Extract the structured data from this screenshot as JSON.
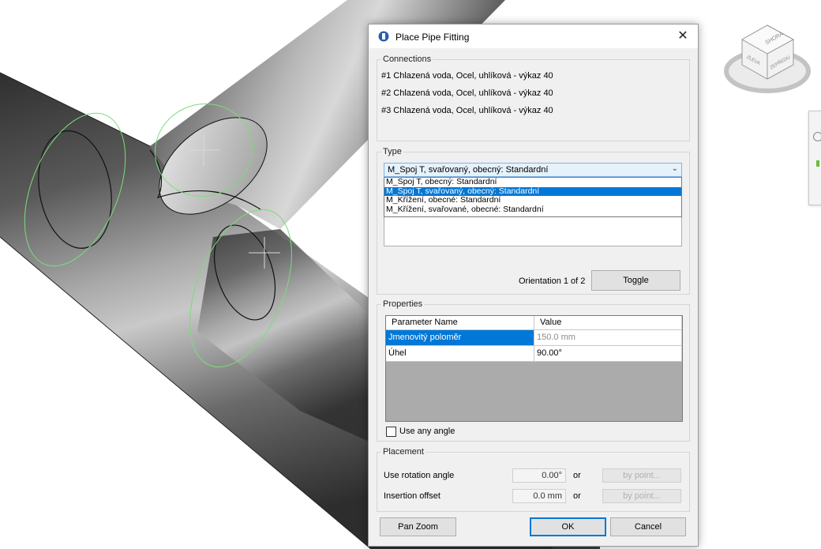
{
  "dialog": {
    "title": "Place Pipe Fitting",
    "close_glyph": "✕",
    "icon": "revit-fitting-icon"
  },
  "connections": {
    "legend": "Connections",
    "items": [
      "#1 Chlazená voda, Ocel, uhlíková - výkaz 40",
      "#2 Chlazená voda, Ocel, uhlíková - výkaz 40",
      "#3 Chlazená voda, Ocel, uhlíková - výkaz 40"
    ]
  },
  "type": {
    "legend": "Type",
    "selected": "M_Spoj T, svařovaný, obecný: Standardní",
    "options": [
      "M_Spoj T, obecný: Standardní",
      "M_Spoj T, svařovaný, obecný: Standardní",
      "M_Křížení, obecné: Standardní",
      "M_Křížení, svařované, obecné: Standardní"
    ],
    "highlighted_index": 1,
    "orientation_text": "Orientation 1 of 2",
    "toggle_label": "Toggle"
  },
  "properties": {
    "legend": "Properties",
    "headers": {
      "name": "Parameter Name",
      "value": "Value"
    },
    "rows": [
      {
        "name": "Jmenovitý poloměr",
        "value": "150.0 mm"
      },
      {
        "name": "Úhel",
        "value": "90.00°"
      }
    ],
    "use_any_angle_label": "Use any angle",
    "use_any_angle_checked": false
  },
  "placement": {
    "legend": "Placement",
    "rotation_label": "Use rotation angle",
    "rotation_value": "0.00°",
    "offset_label": "Insertion offset",
    "offset_value": "0.0 mm",
    "or_text": "or",
    "by_point_label": "by point..."
  },
  "footer": {
    "pan_zoom": "Pan Zoom",
    "ok": "OK",
    "cancel": "Cancel"
  },
  "viewcube": {
    "top_label": "SHORA",
    "left_label": "ZLEVA",
    "right_label": "ZEPŘEDU"
  },
  "colors": {
    "selection": "#0078d7",
    "outline_green": "#7bdc7b",
    "pipe_dark": "#4a4a4a",
    "pipe_light": "#c4c4c4"
  }
}
